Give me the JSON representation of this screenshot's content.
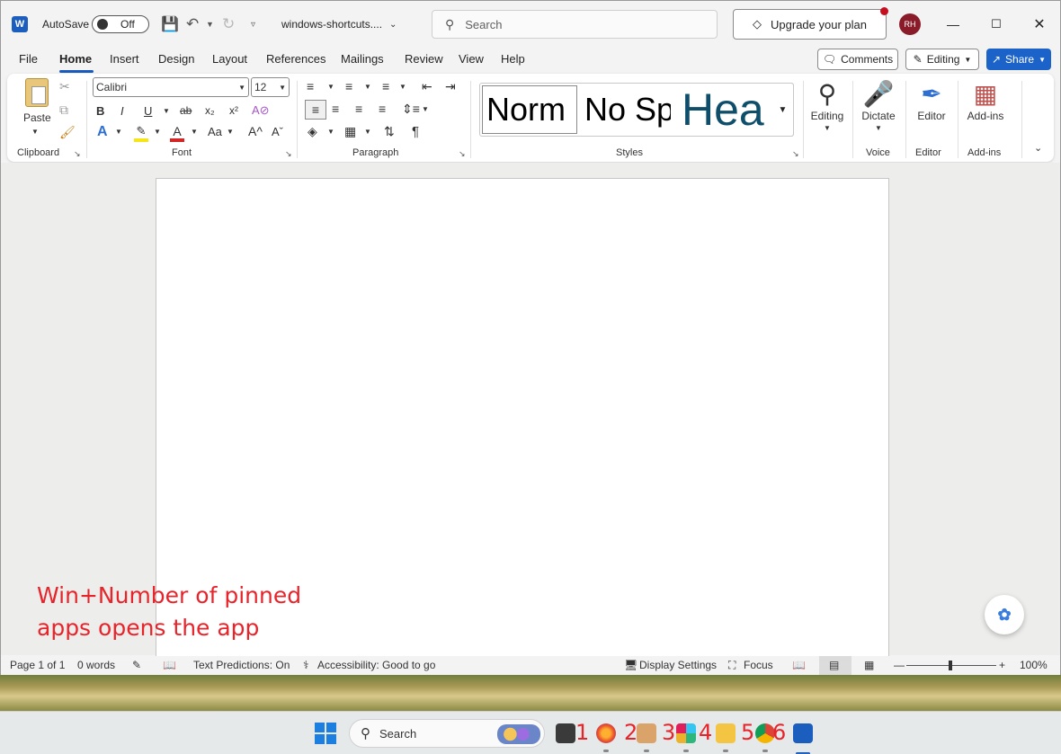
{
  "titlebar": {
    "app_logo": "W",
    "autosave_label": "AutoSave",
    "autosave_state": "Off",
    "doc_title": "windows-shortcuts....",
    "search_placeholder": "Search",
    "upgrade_label": "Upgrade your plan",
    "avatar_initials": "RH"
  },
  "tabs": [
    "File",
    "Home",
    "Insert",
    "Design",
    "Layout",
    "References",
    "Mailings",
    "Review",
    "View",
    "Help"
  ],
  "active_tab": "Home",
  "actions": {
    "comments": "Comments",
    "editing": "Editing",
    "share": "Share"
  },
  "ribbon": {
    "clipboard": {
      "paste_label": "Paste",
      "group_label": "Clipboard"
    },
    "font": {
      "font_name": "Calibri",
      "font_size": "12",
      "group_label": "Font",
      "bold": "B",
      "italic": "I",
      "underline": "U",
      "strike": "ab",
      "subscript": "x₂",
      "superscript": "x²",
      "change_case": "Aa",
      "grow": "A^",
      "shrink": "Aˇ"
    },
    "paragraph": {
      "group_label": "Paragraph"
    },
    "styles": {
      "group_label": "Styles",
      "items": [
        "Norm",
        "No Sp",
        "Hea"
      ]
    },
    "editing": {
      "label": "Editing"
    },
    "voice": {
      "button_label": "Dictate",
      "group_label": "Voice"
    },
    "editor": {
      "button_label": "Editor",
      "group_label": "Editor"
    },
    "addins": {
      "button_label": "Add-ins",
      "group_label": "Add-ins"
    }
  },
  "document": {
    "annotation_line1": "Win+Number of pinned",
    "annotation_line2": "apps opens the app"
  },
  "statusbar": {
    "page": "Page 1 of 1",
    "words": "0 words",
    "text_predictions": "Text Predictions: On",
    "accessibility": "Accessibility: Good to go",
    "display_settings": "Display Settings",
    "focus": "Focus",
    "zoom": "100%",
    "zoom_level": 1.0
  },
  "taskbar": {
    "search_placeholder": "Search",
    "pinned_numbers": [
      "1",
      "2",
      "3",
      "4",
      "5",
      "6"
    ]
  },
  "colors": {
    "accent": "#185abd",
    "annotation": "#e8242b",
    "heading_style": "#0e4e6b"
  }
}
